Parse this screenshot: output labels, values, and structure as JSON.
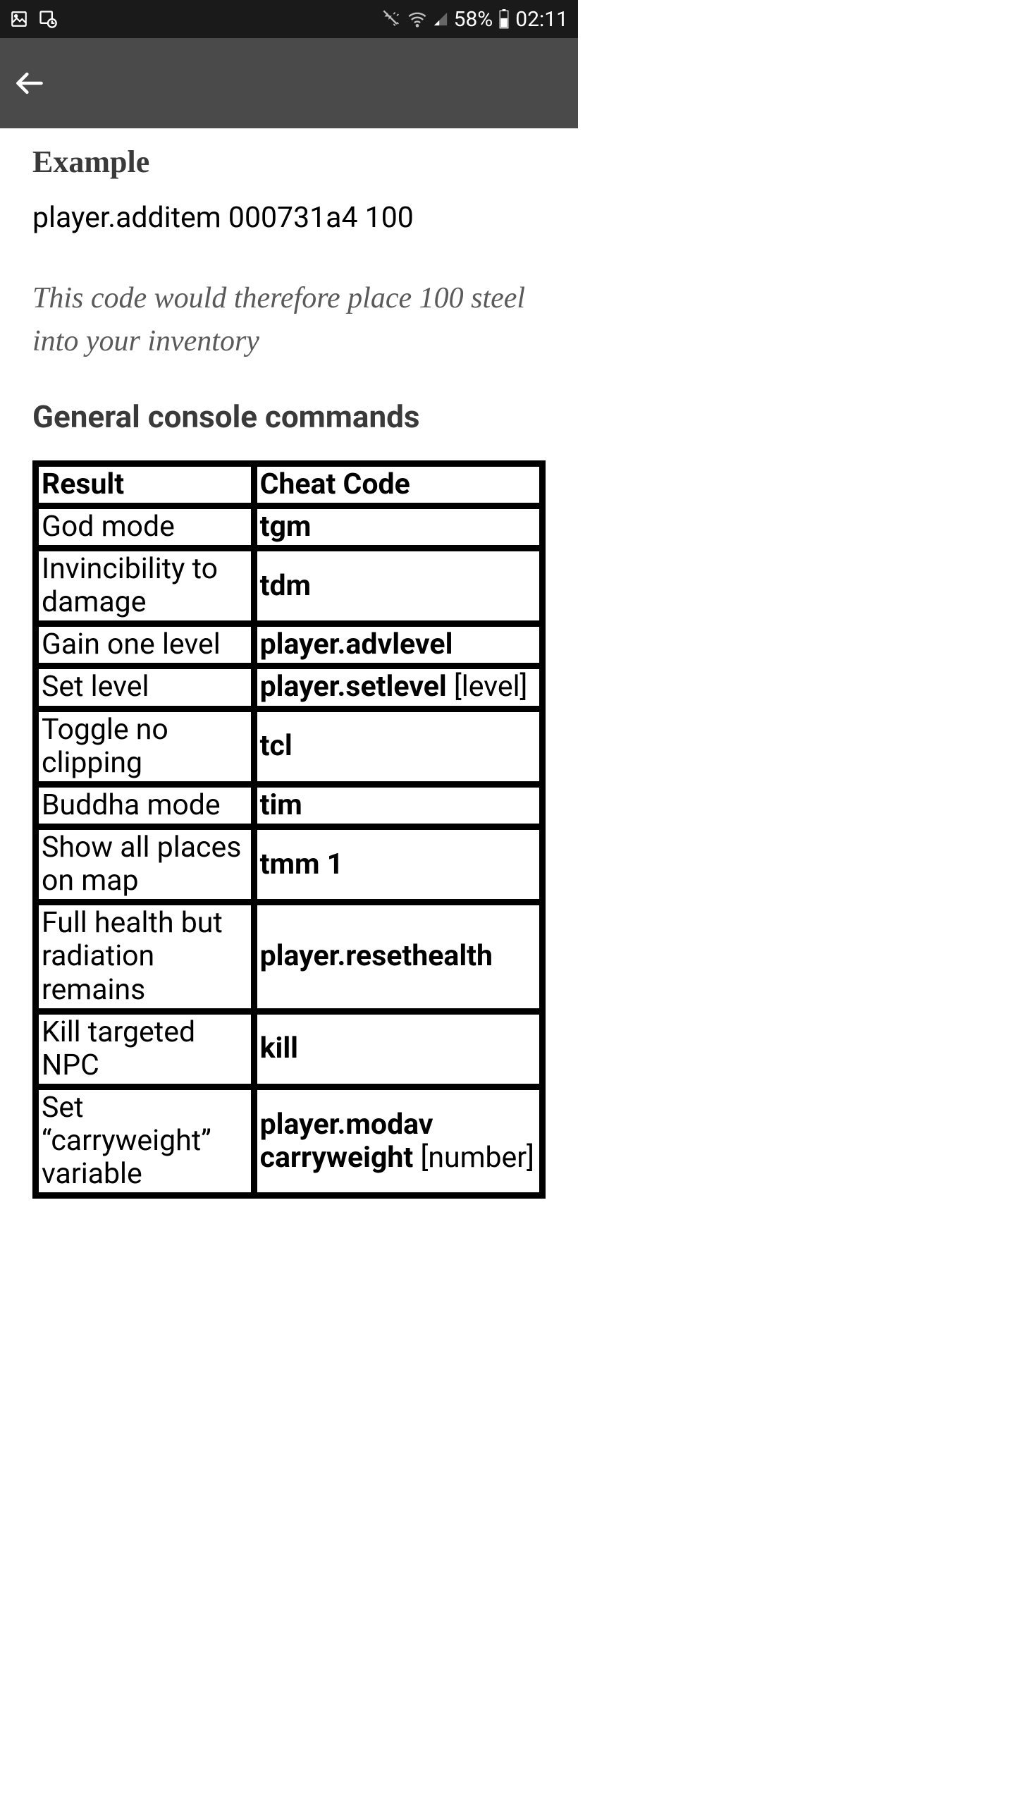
{
  "statusBar": {
    "battery": "58%",
    "time": "02:11"
  },
  "content": {
    "exampleHeading": "Example",
    "exampleCode": "player.additem 000731a4 100",
    "exampleDesc": "This code would therefore place 100 steel into your inventory",
    "sectionHeading": "General console commands",
    "tableHeaders": {
      "result": "Result",
      "cheat": "Cheat Code"
    },
    "rows": [
      {
        "result": "God mode",
        "cheat_bold": "tgm",
        "cheat_plain": ""
      },
      {
        "result": "Invincibility to damage",
        "cheat_bold": "tdm",
        "cheat_plain": ""
      },
      {
        "result": "Gain one level",
        "cheat_bold": "player.advlevel",
        "cheat_plain": ""
      },
      {
        "result": "Set level",
        "cheat_bold": "player.setlevel",
        "cheat_plain": " [level]"
      },
      {
        "result": "Toggle no clipping",
        "cheat_bold": "tcl",
        "cheat_plain": ""
      },
      {
        "result": "Buddha mode",
        "cheat_bold": "tim",
        "cheat_plain": ""
      },
      {
        "result": "Show all places on map",
        "cheat_bold": "tmm 1",
        "cheat_plain": ""
      },
      {
        "result": "Full health but radiation remains",
        "cheat_bold": "player.resethealth",
        "cheat_plain": ""
      },
      {
        "result": "Kill targeted NPC",
        "cheat_bold": "kill",
        "cheat_plain": ""
      },
      {
        "result": "Set “carryweight” variable",
        "cheat_bold": "player.modav carryweight",
        "cheat_plain": " [number]"
      }
    ]
  }
}
